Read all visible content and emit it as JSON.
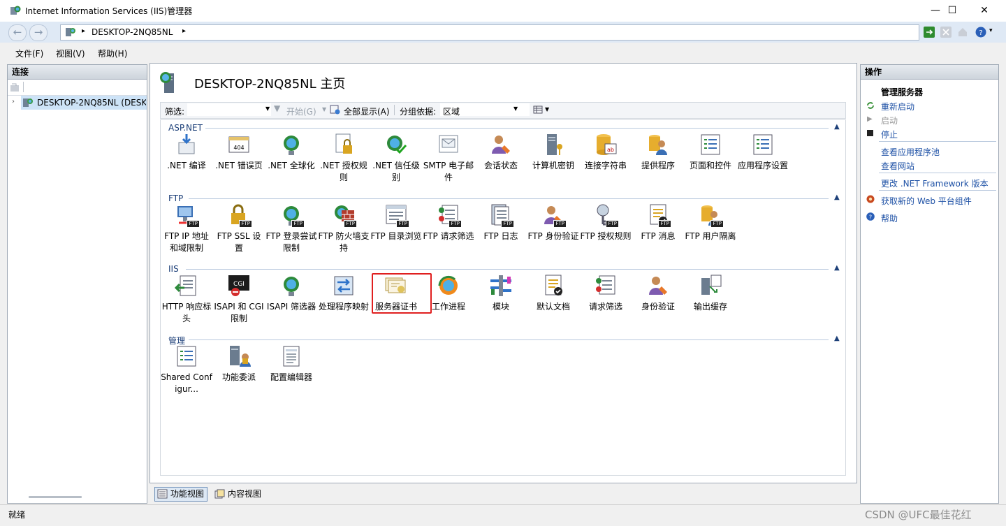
{
  "window": {
    "title": "Internet Information Services (IIS)管理器",
    "minimize": "—",
    "maximize": "☐",
    "close": "✕"
  },
  "address": {
    "path": "DESKTOP-2NQ85NL",
    "sep": "▸",
    "sep2": "▸"
  },
  "menu": [
    "文件(F)",
    "视图(V)",
    "帮助(H)"
  ],
  "connections": {
    "header": "连接",
    "tree_node": "DESKTOP-2NQ85NL (DESK"
  },
  "center": {
    "title": "DESKTOP-2NQ85NL 主页",
    "filter_label": "筛选:",
    "start_label": "开始(G)",
    "show_all_label": "全部显示(A)",
    "group_by_label": "分组依据:",
    "group_by_value": "区域",
    "sections": [
      {
        "title": "ASP.NET",
        "items": [
          ".NET 编译",
          ".NET 错误页",
          ".NET 全球化",
          ".NET 授权规则",
          ".NET 信任级别",
          "SMTP 电子邮件",
          "会话状态",
          "计算机密钥",
          "连接字符串",
          "提供程序",
          "页面和控件",
          "应用程序设置"
        ]
      },
      {
        "title": "FTP",
        "items": [
          "FTP IP 地址和域限制",
          "FTP SSL 设置",
          "FTP 登录尝试限制",
          "FTP 防火墙支持",
          "FTP 目录浏览",
          "FTP 请求筛选",
          "FTP 日志",
          "FTP 身份验证",
          "FTP 授权规则",
          "FTP 消息",
          "FTP 用户隔离"
        ]
      },
      {
        "title": "IIS",
        "items": [
          "HTTP 响应标头",
          "ISAPI 和 CGI 限制",
          "ISAPI 筛选器",
          "处理程序映射",
          "服务器证书",
          "工作进程",
          "模块",
          "默认文档",
          "请求筛选",
          "身份验证",
          "输出缓存"
        ]
      },
      {
        "title": "管理",
        "items": [
          "Shared Configur...",
          "功能委派",
          "配置编辑器"
        ]
      }
    ],
    "tabs": [
      "功能视图",
      "内容视图"
    ]
  },
  "actions": {
    "header": "操作",
    "group_title": "管理服务器",
    "restart": "重新启动",
    "start": "启动",
    "stop": "停止",
    "view_app_pools": "查看应用程序池",
    "view_sites": "查看网站",
    "change_net": "更改 .NET Framework 版本",
    "get_web_components": "获取新的 Web 平台组件",
    "help": "帮助"
  },
  "status": {
    "text": "就绪",
    "watermark": "CSDN @UFC最佳花红"
  },
  "colors": {
    "accent": "#1f52a6",
    "highlight_box": "#e01f1f"
  }
}
